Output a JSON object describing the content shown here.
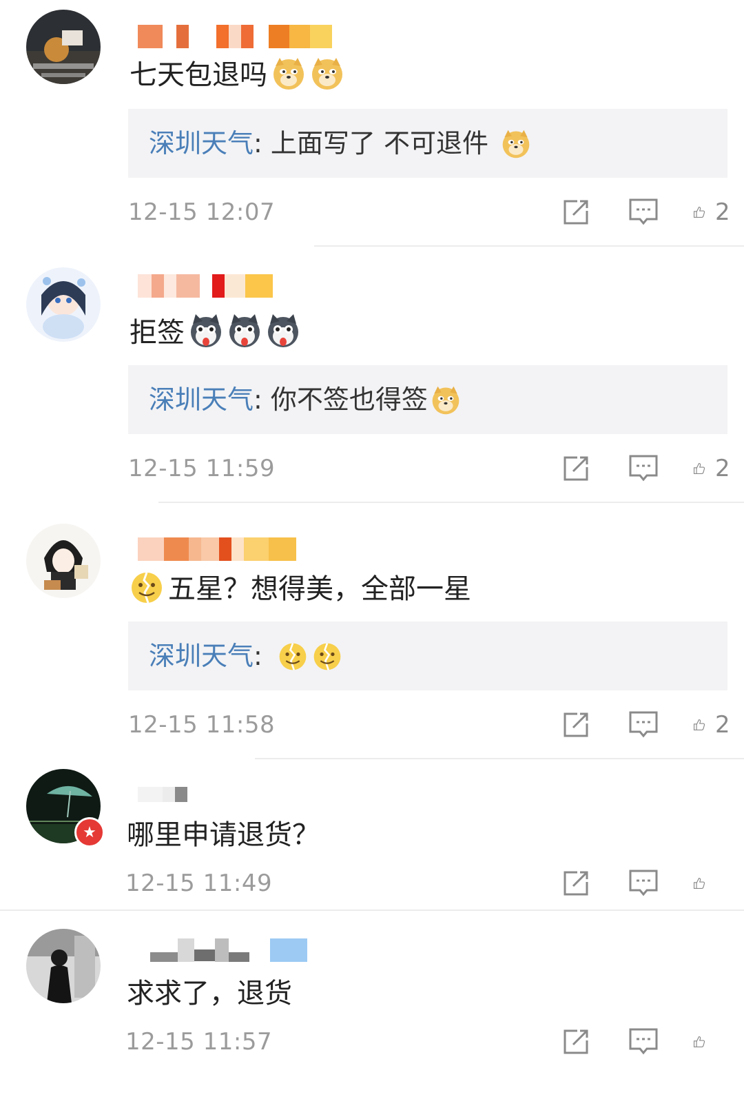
{
  "comments": [
    {
      "text": "七天包退吗",
      "reply_author": "深圳天气",
      "reply_text": "上面写了 不可退件",
      "time": "12-15 12:07",
      "likes": "2"
    },
    {
      "text": "拒签",
      "reply_author": "深圳天气",
      "reply_text": "你不签也得签",
      "time": "12-15 11:59",
      "likes": "2"
    },
    {
      "text": "五星？想得美，全部一星",
      "reply_author": "深圳天气",
      "reply_text": "",
      "time": "12-15 11:58",
      "likes": "2"
    },
    {
      "text": "哪里申请退货？",
      "time": "12-15 11:49",
      "likes": ""
    },
    {
      "text": "求求了，退货",
      "time": "12-15 11:57",
      "likes": ""
    }
  ],
  "icons": {
    "repost": "share-square-icon",
    "comment": "comment-bubble-icon",
    "like": "thumbs-up-icon",
    "doge": "doge-emoji",
    "husky": "husky-emoji",
    "broken_smile": "cracked-smile-emoji"
  },
  "colors": {
    "reply_author": "#4a7fb8",
    "reply_bg": "#f3f3f5",
    "meta": "#9b9b9b",
    "badge": "#e53935"
  },
  "separator": ": "
}
